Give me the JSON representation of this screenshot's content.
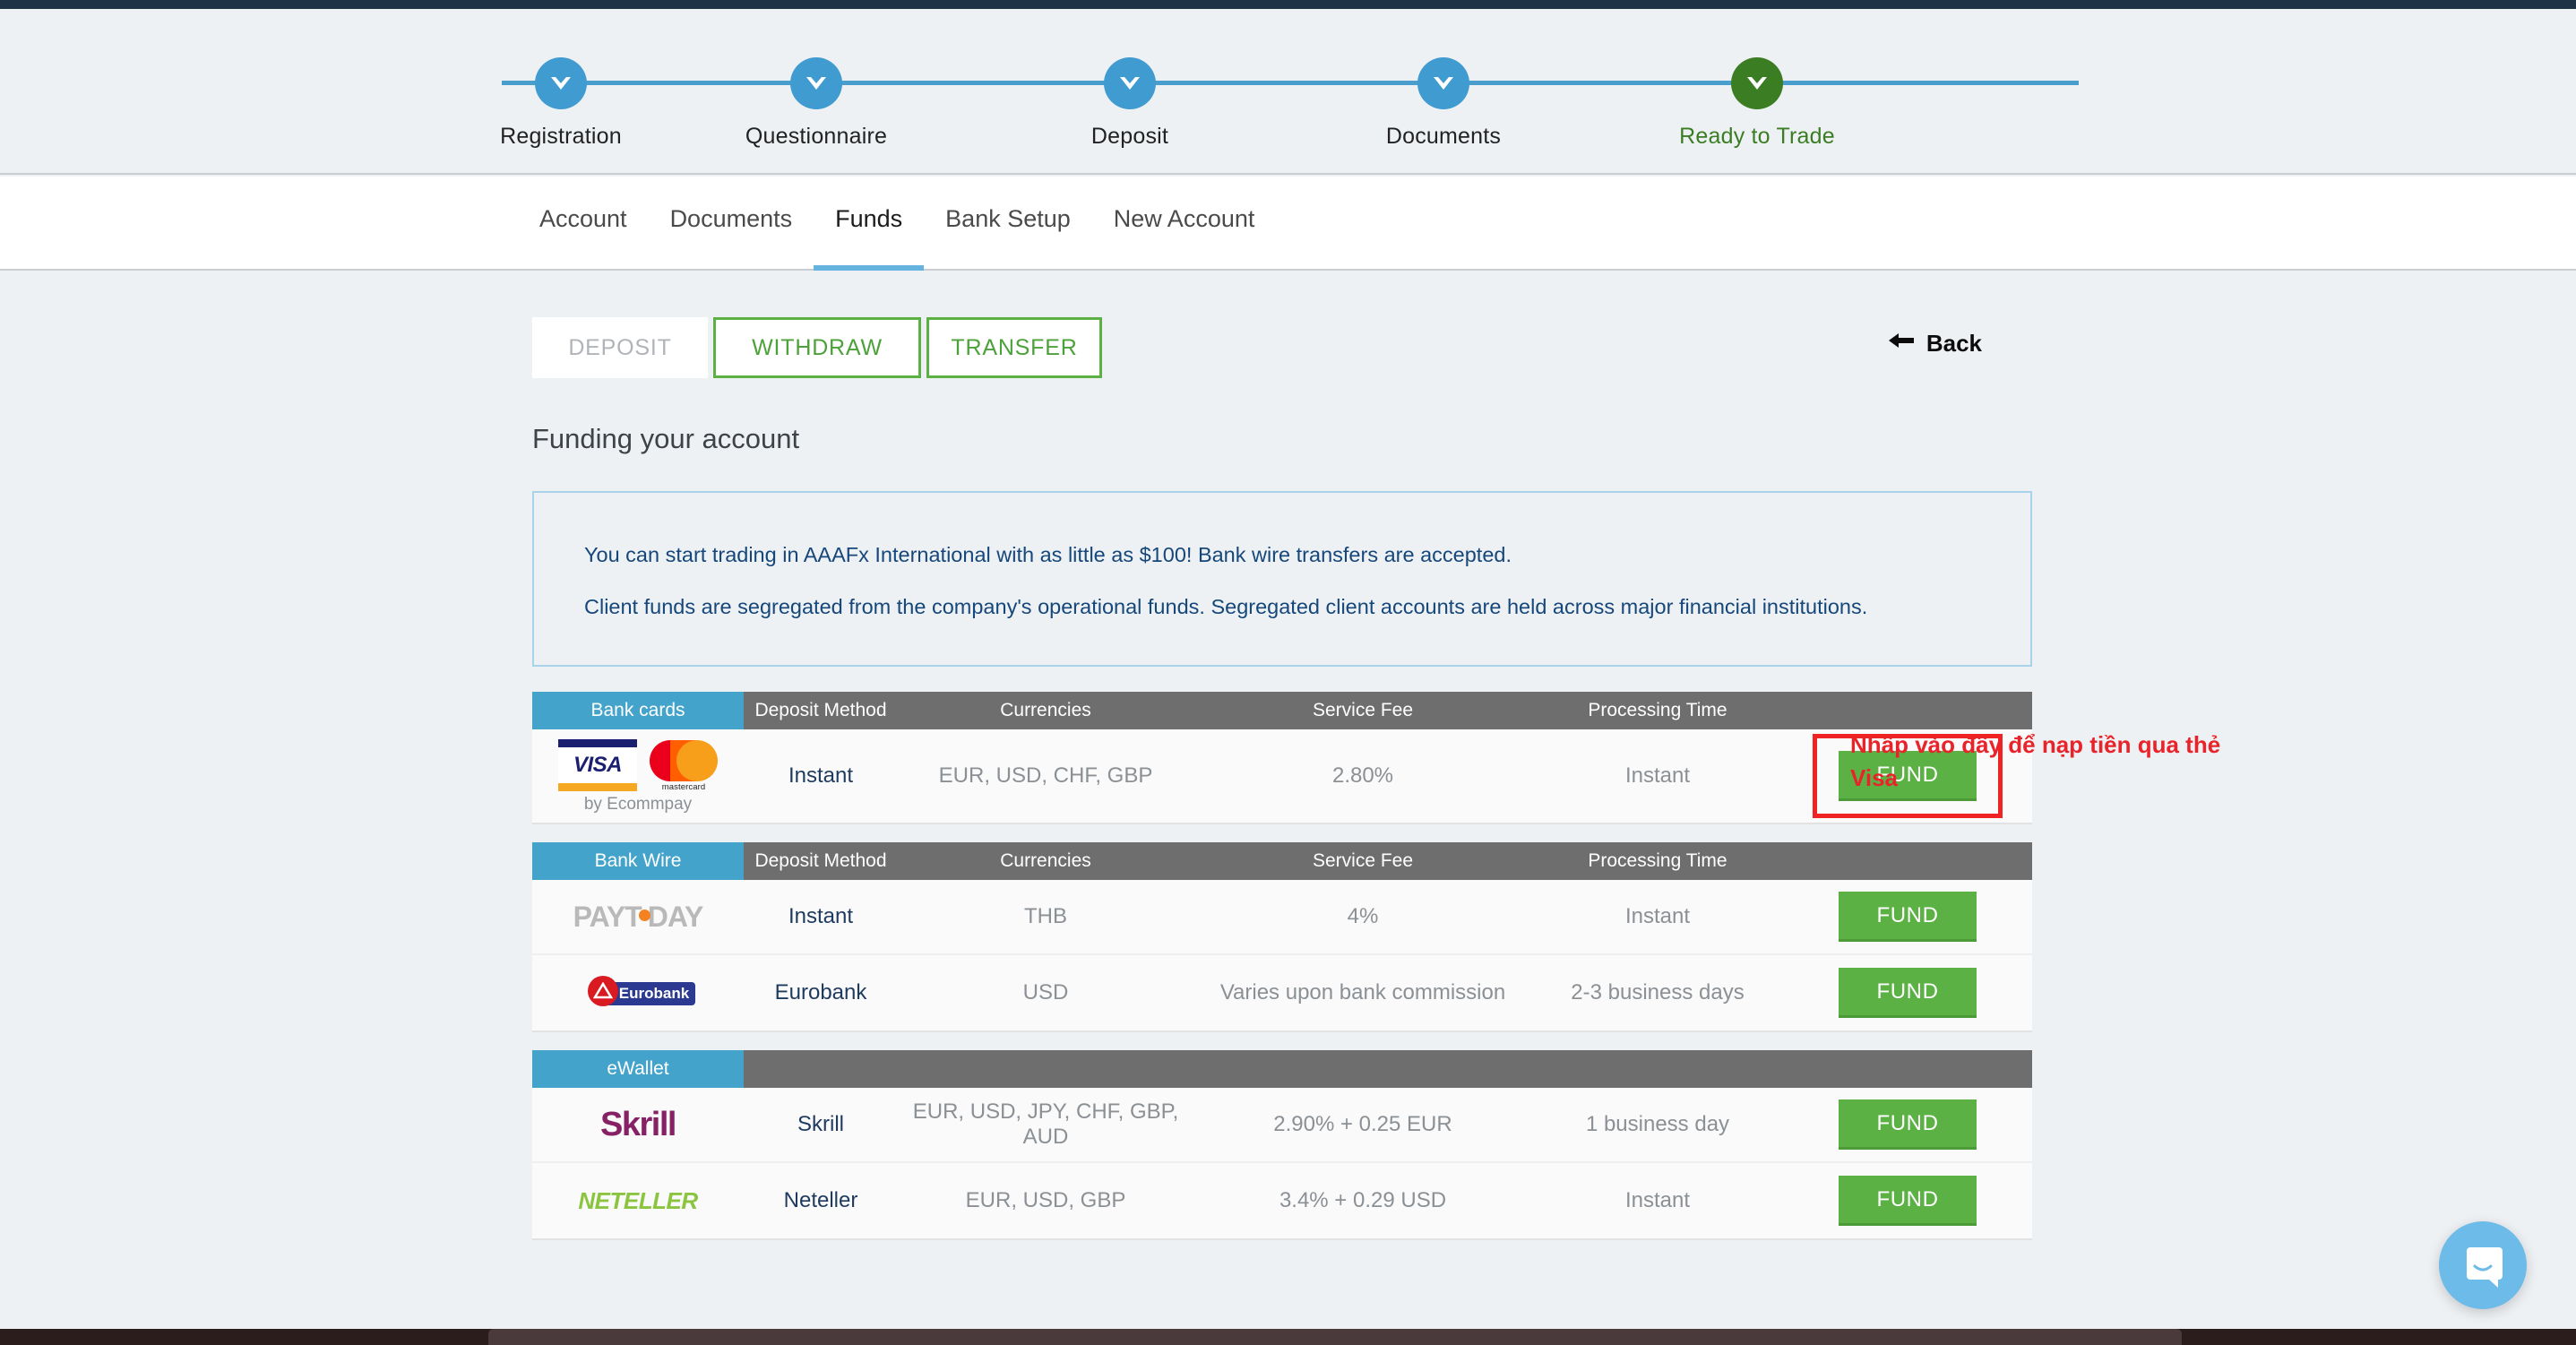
{
  "stepper": {
    "steps": [
      {
        "label": "Registration",
        "state": "done",
        "icon": "check-icon"
      },
      {
        "label": "Questionnaire",
        "state": "done",
        "icon": "check-icon"
      },
      {
        "label": "Deposit",
        "state": "done",
        "icon": "check-icon"
      },
      {
        "label": "Documents",
        "state": "done",
        "icon": "check-icon"
      },
      {
        "label": "Ready to Trade",
        "state": "current",
        "icon": "check-icon"
      }
    ],
    "done_color": "#3f9bd0",
    "current_color": "#3b7d23",
    "line_color": "#4a9ecd"
  },
  "nav": {
    "tabs": [
      {
        "label": "Account",
        "active": false
      },
      {
        "label": "Documents",
        "active": false
      },
      {
        "label": "Funds",
        "active": true
      },
      {
        "label": "Bank Setup",
        "active": false
      },
      {
        "label": "New Account",
        "active": false
      }
    ],
    "active_underline_color": "#65b4e0"
  },
  "toolbar": {
    "segments": [
      {
        "label": "DEPOSIT",
        "active": false
      },
      {
        "label": "WITHDRAW",
        "active": true
      },
      {
        "label": "TRANSFER",
        "active": true
      }
    ],
    "back_label": "Back",
    "back_icon": "arrow-left-icon",
    "accent_green": "#5cb145"
  },
  "page_title": "Funding your account",
  "info": {
    "lines": [
      "You can start trading in AAAFx International with as little as $100! Bank wire transfers are accepted.",
      "Client funds are segregated from the company's operational funds. Segregated client accounts are held across major financial institutions."
    ],
    "border_color": "#a9d3ea",
    "text_color": "#15477a"
  },
  "columns": [
    "Deposit Method",
    "Currencies",
    "Service Fee",
    "Processing Time"
  ],
  "tables": [
    {
      "category": "Bank cards",
      "show_columns": true,
      "rows": [
        {
          "logo": "visa-mastercard-ecommpay-logo",
          "logo_caption": "by Ecommpay",
          "method": "Instant",
          "currencies": "EUR, USD, CHF, GBP",
          "fee": "2.80%",
          "time": "Instant",
          "action": "FUND",
          "highlighted": true
        }
      ]
    },
    {
      "category": "Bank Wire",
      "show_columns": true,
      "rows": [
        {
          "logo": "paytoday-logo",
          "logo_text": "PAYT DAY",
          "method": "Instant",
          "currencies": "THB",
          "fee": "4%",
          "time": "Instant",
          "action": "FUND",
          "highlighted": false
        },
        {
          "logo": "eurobank-logo",
          "logo_text": "Eurobank",
          "method": "Eurobank",
          "currencies": "USD",
          "fee": "Varies upon bank commission",
          "time": "2-3 business days",
          "action": "FUND",
          "highlighted": false
        }
      ]
    },
    {
      "category": "eWallet",
      "show_columns": false,
      "rows": [
        {
          "logo": "skrill-logo",
          "logo_text": "Skrill",
          "method": "Skrill",
          "currencies": "EUR, USD, JPY, CHF, GBP, AUD",
          "fee": "2.90% + 0.25 EUR",
          "time": "1 business day",
          "action": "FUND",
          "highlighted": false
        },
        {
          "logo": "neteller-logo",
          "logo_text": "NETELLER",
          "method": "Neteller",
          "currencies": "EUR, USD, GBP",
          "fee": "3.4% + 0.29 USD",
          "time": "Instant",
          "action": "FUND",
          "highlighted": false
        }
      ]
    }
  ],
  "annotation": {
    "text": "Nhấp vào đây để nạp tiền qua thẻ Visa",
    "color": "#e8242a"
  },
  "chat": {
    "icon": "chat-bubble-icon",
    "color": "#6cbbe8"
  }
}
